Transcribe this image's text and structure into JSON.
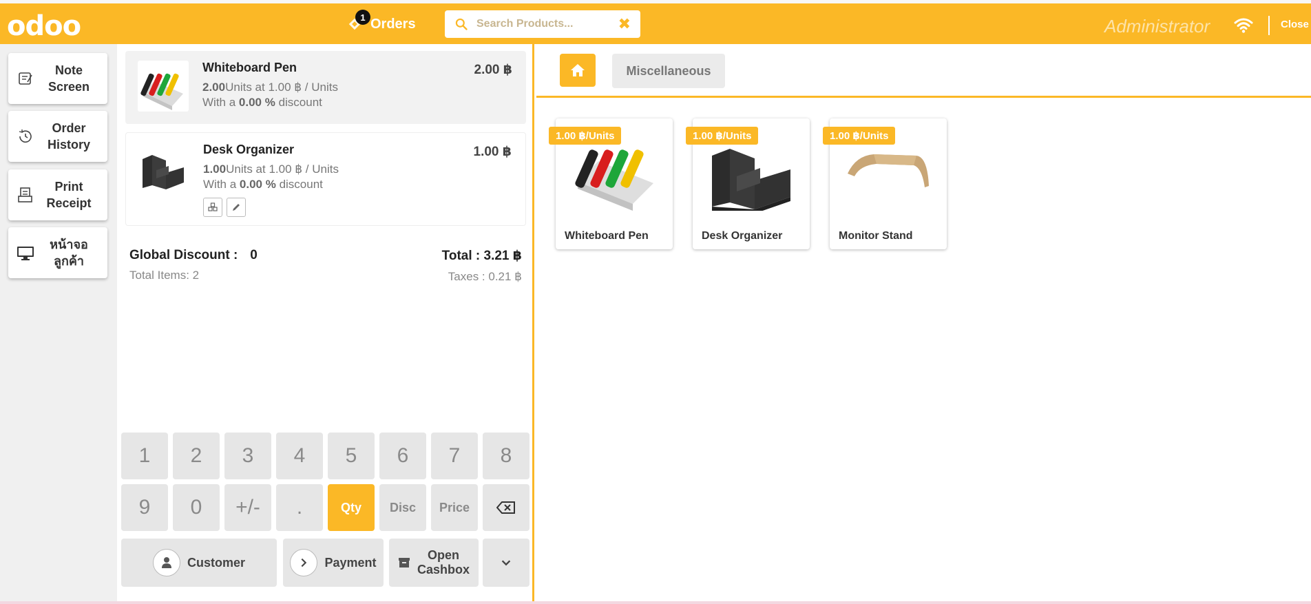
{
  "header": {
    "logo": "odoo",
    "orders_label": "Orders",
    "orders_count": "1",
    "search_placeholder": "Search Products...",
    "cashier": "Administrator",
    "close_label": "Close"
  },
  "controls": [
    {
      "label_line1": "Note",
      "label_line2": "Screen",
      "icon": "note-icon"
    },
    {
      "label_line1": "Order",
      "label_line2": "History",
      "icon": "history-icon"
    },
    {
      "label_line1": "Print",
      "label_line2": "Receipt",
      "icon": "receipt-icon"
    },
    {
      "label_line1": "หน้าจอ",
      "label_line2": "ลูกค้า",
      "icon": "monitor-icon"
    }
  ],
  "orderlines": [
    {
      "name": "Whiteboard Pen",
      "price": "2.00 ฿",
      "qty": "2.00",
      "unit_text": "Units at 1.00 ฿ / Units",
      "discount_prefix": "With a ",
      "discount": "0.00 %",
      "discount_suffix": " discount"
    },
    {
      "name": "Desk Organizer",
      "price": "1.00 ฿",
      "qty": "1.00",
      "unit_text": "Units at 1.00 ฿ / Units",
      "discount_prefix": "With a ",
      "discount": "0.00 %",
      "discount_suffix": " discount"
    }
  ],
  "summary": {
    "global_discount_label": "Global Discount :",
    "global_discount_value": "0",
    "total_items": "Total Items: 2",
    "total": "Total : 3.21 ฿",
    "taxes": "Taxes : 0.21 ฿"
  },
  "numpad": {
    "keys_row1": [
      "1",
      "2",
      "3",
      "4",
      "5",
      "6",
      "7",
      "8"
    ],
    "keys_row2": [
      "9",
      "0",
      "+/-",
      ".",
      "Qty",
      "Disc",
      "Price"
    ],
    "active_mode": "Qty",
    "customer_label": "Customer",
    "payment_label": "Payment",
    "cashbox_line1": "Open",
    "cashbox_line2": "Cashbox"
  },
  "category": {
    "current": "Miscellaneous"
  },
  "products": [
    {
      "name": "Whiteboard Pen",
      "price": "1.00 ฿/Units"
    },
    {
      "name": "Desk Organizer",
      "price": "1.00 ฿/Units"
    },
    {
      "name": "Monitor Stand",
      "price": "1.00 ฿/Units"
    }
  ],
  "colors": {
    "brand": "#fbb826",
    "panel_bg": "#f0f0f0",
    "key_bg": "#e6e6e6"
  }
}
